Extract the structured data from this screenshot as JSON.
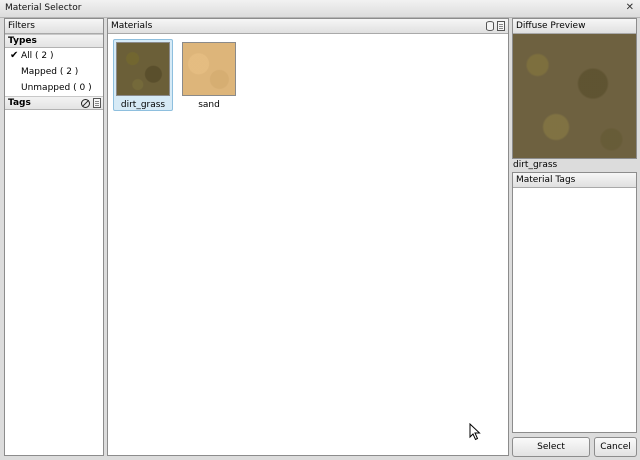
{
  "window": {
    "title": "Material Selector",
    "close_glyph": "✕"
  },
  "filters": {
    "header": "Filters",
    "types_header": "Types",
    "types": [
      {
        "label": "All ( 2 )",
        "checked": true,
        "check_glyph": "✔"
      },
      {
        "label": "Mapped ( 2 )",
        "checked": false
      },
      {
        "label": "Unmapped ( 0 )",
        "checked": false
      }
    ],
    "tags_header": "Tags",
    "tags_icons": [
      "clear-tags-icon",
      "tag-list-icon"
    ]
  },
  "materials": {
    "header": "Materials",
    "header_icons": [
      "database-icon",
      "page-icon"
    ],
    "items": [
      {
        "name": "dirt_grass",
        "selected": true
      },
      {
        "name": "sand",
        "selected": false
      }
    ]
  },
  "preview": {
    "header": "Diffuse Preview",
    "material_name": "dirt_grass"
  },
  "material_tags": {
    "header": "Material Tags"
  },
  "buttons": {
    "select": "Select",
    "cancel": "Cancel"
  },
  "colors": {
    "selection_bg": "#d6eaf6",
    "selection_border": "#8ebfde"
  }
}
